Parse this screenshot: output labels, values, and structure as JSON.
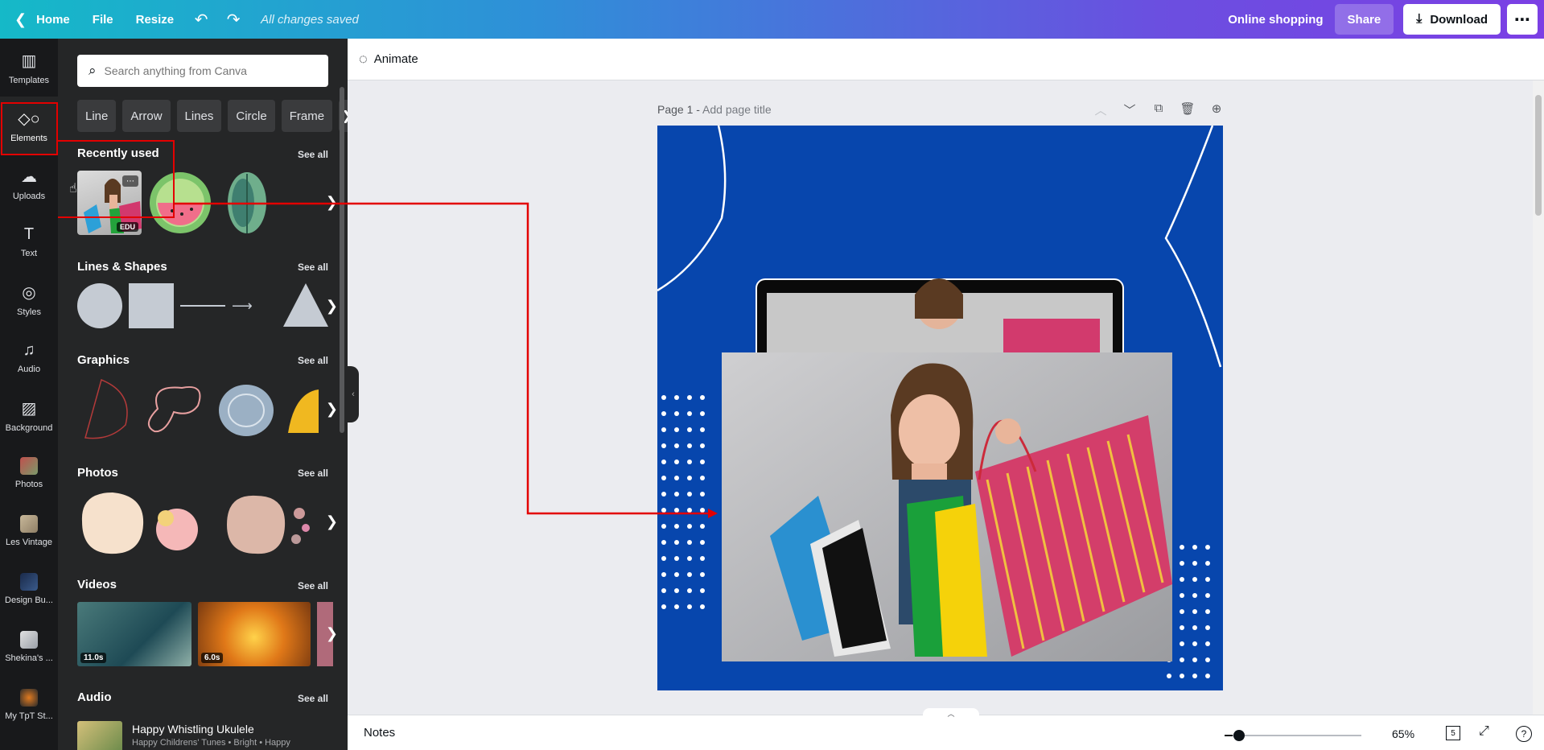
{
  "topbar": {
    "home": "Home",
    "file": "File",
    "resize": "Resize",
    "undo_icon": "undo-icon",
    "redo_icon": "redo-icon",
    "saved_status": "All changes saved",
    "doc_title": "Online shopping",
    "share": "Share",
    "download": "Download",
    "more_icon": "more-icon"
  },
  "rail": {
    "items": [
      {
        "label": "Templates",
        "icon": "templates-icon"
      },
      {
        "label": "Elements",
        "icon": "elements-icon",
        "active": true
      },
      {
        "label": "Uploads",
        "icon": "upload-icon"
      },
      {
        "label": "Text",
        "icon": "text-icon"
      },
      {
        "label": "Styles",
        "icon": "styles-icon"
      },
      {
        "label": "Audio",
        "icon": "audio-icon"
      },
      {
        "label": "Background",
        "icon": "background-icon"
      },
      {
        "label": "Photos",
        "icon": "photos-icon"
      },
      {
        "label": "Les Vintage",
        "icon": "les-vintage-icon"
      },
      {
        "label": "Design Bu...",
        "icon": "design-bundle-icon"
      },
      {
        "label": "Shekina's ...",
        "icon": "shekinas-icon"
      },
      {
        "label": "My TpT St...",
        "icon": "my-tpt-icon"
      }
    ]
  },
  "panel": {
    "search_placeholder": "Search anything from Canva",
    "chips": [
      "Line",
      "Arrow",
      "Lines",
      "Circle",
      "Frame"
    ],
    "sections": {
      "recently_used": "Recently used",
      "lines_shapes": "Lines & Shapes",
      "graphics": "Graphics",
      "photos": "Photos",
      "videos": "Videos",
      "audio": "Audio"
    },
    "see_all": "See all",
    "recent_badge": "EDU",
    "videos": [
      {
        "duration": "11.0s"
      },
      {
        "duration": "6.0s"
      }
    ],
    "audio_item": {
      "title": "Happy Whistling Ukulele",
      "subtitle": "Happy Childrens' Tunes • Bright • Happy"
    }
  },
  "canvas": {
    "animate": "Animate",
    "page_label": "Page 1",
    "page_title_placeholder": "Add page title",
    "notes": "Notes",
    "zoom": "65%",
    "pages_count": "5",
    "help": "?",
    "zoom_level": 0.05
  },
  "colors": {
    "artboard": "#0746ad",
    "highlight": "#e30000",
    "panel_bg": "#252627",
    "rail_bg": "#18191b"
  }
}
